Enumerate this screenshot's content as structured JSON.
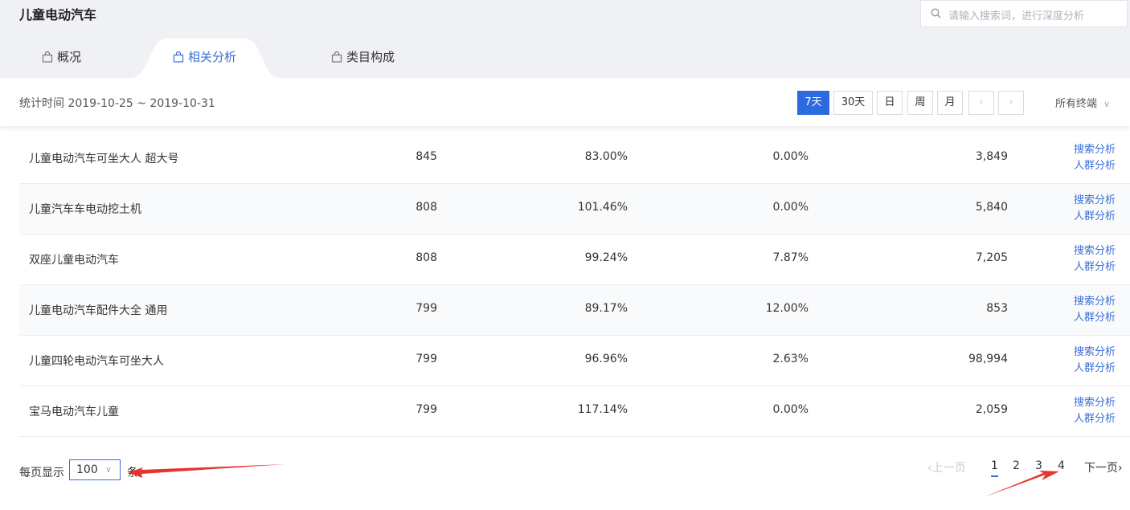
{
  "header": {
    "title": "儿童电动汽车",
    "search_placeholder": "请输入搜索词，进行深度分析"
  },
  "tabs": [
    {
      "label": "概况",
      "active": false
    },
    {
      "label": "相关分析",
      "active": true
    },
    {
      "label": "类目构成",
      "active": false
    }
  ],
  "filter": {
    "stat_time": "统计时间 2019-10-25 ~ 2019-10-31",
    "ranges": [
      "7天",
      "30天",
      "日",
      "周",
      "月"
    ],
    "active_range": "7天",
    "prev_icon": "‹",
    "next_icon": "›",
    "terminal": "所有终端"
  },
  "table": {
    "rows": [
      {
        "keyword": "儿童电动汽车可坐大人 超大号",
        "a": "845",
        "b": "83.00%",
        "c": "0.00%",
        "d": "3,849"
      },
      {
        "keyword": "儿童汽车车电动挖土机",
        "a": "808",
        "b": "101.46%",
        "c": "0.00%",
        "d": "5,840"
      },
      {
        "keyword": "双座儿童电动汽车",
        "a": "808",
        "b": "99.24%",
        "c": "7.87%",
        "d": "7,205"
      },
      {
        "keyword": "儿童电动汽车配件大全 通用",
        "a": "799",
        "b": "89.17%",
        "c": "12.00%",
        "d": "853"
      },
      {
        "keyword": "儿童四轮电动汽车可坐大人",
        "a": "799",
        "b": "96.96%",
        "c": "2.63%",
        "d": "98,994"
      },
      {
        "keyword": "宝马电动汽车儿童",
        "a": "799",
        "b": "117.14%",
        "c": "0.00%",
        "d": "2,059"
      }
    ],
    "actions": {
      "search": "搜索分析",
      "crowd": "人群分析"
    }
  },
  "pagination": {
    "per_page_label": "每页显示",
    "per_page_value": "100",
    "per_page_unit": "条",
    "prev": "上一页",
    "pages": [
      "1",
      "2",
      "3",
      "4"
    ],
    "current": "1",
    "next": "下一页"
  },
  "colors": {
    "accent": "#2d6ae0",
    "link": "#3a6fd8",
    "annotation": "#e8322c"
  }
}
